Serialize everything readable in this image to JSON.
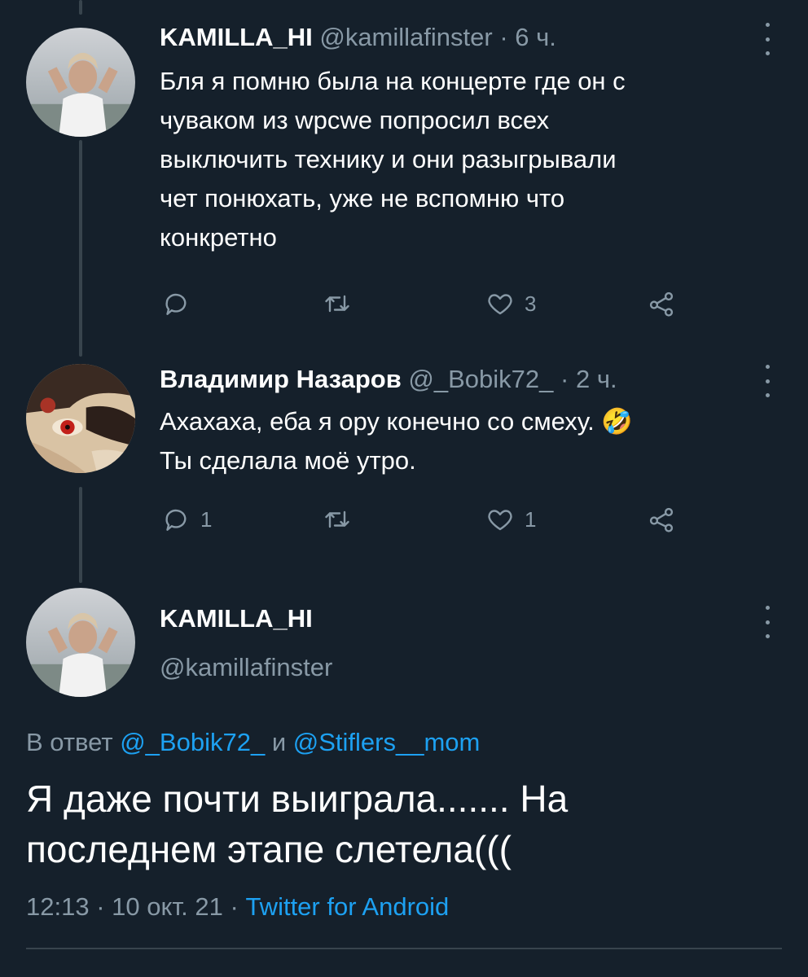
{
  "thread": [
    {
      "name": "KAMILLA_HI",
      "handle": "@kamillafinster",
      "sep": "·",
      "time": "6 ч.",
      "text": "Бля я помню была на концерте где он с\nчуваком из wpcwe попросил всех\nвыключить технику и они разыгрывали\nчет понюхать, уже не вспомню что\nконкретно",
      "replies": "",
      "retweets": "",
      "likes": "3"
    },
    {
      "name": "Владимир Назаров",
      "handle": "@_Bobik72_",
      "sep": "·",
      "time": "2 ч.",
      "text": "Ахахаха, еба я ору конечно со смеху. 🤣\nТы сделала моё утро.",
      "replies": "1",
      "retweets": "",
      "likes": "1"
    }
  ],
  "main": {
    "name": "KAMILLA_HI",
    "handle": "@kamillafinster",
    "reply_prefix": "В ответ",
    "reply_user1": "@_Bobik72_",
    "reply_and": "и",
    "reply_user2": "@Stiflers__mom",
    "text": "Я даже почти выиграла....... На\nпоследнем этапе слетела(((",
    "time": "12:13",
    "sep1": "·",
    "date": "10 окт. 21",
    "sep2": "·",
    "source": "Twitter for Android"
  },
  "colors": {
    "background": "#15202b",
    "text": "#ffffff",
    "muted": "#8899a6",
    "link": "#1da1f2",
    "line": "#38444d"
  },
  "icons": [
    "reply-icon",
    "retweet-icon",
    "like-icon",
    "share-icon",
    "more-icon"
  ]
}
